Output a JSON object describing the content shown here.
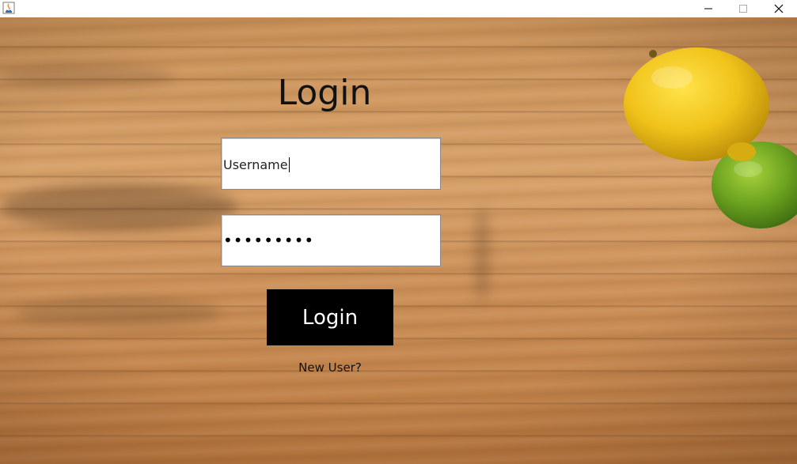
{
  "titlebar": {
    "app_icon": "java-app-icon",
    "minimize_icon": "minimize-icon",
    "maximize_icon": "maximize-icon",
    "close_icon": "close-icon"
  },
  "login": {
    "title": "Login",
    "username_value": "Username",
    "password_masked": "•••••••••",
    "login_button_label": "Login",
    "new_user_link": "New User?"
  },
  "background": {
    "description_icon": "wooden-board-with-lemon-and-lime"
  }
}
